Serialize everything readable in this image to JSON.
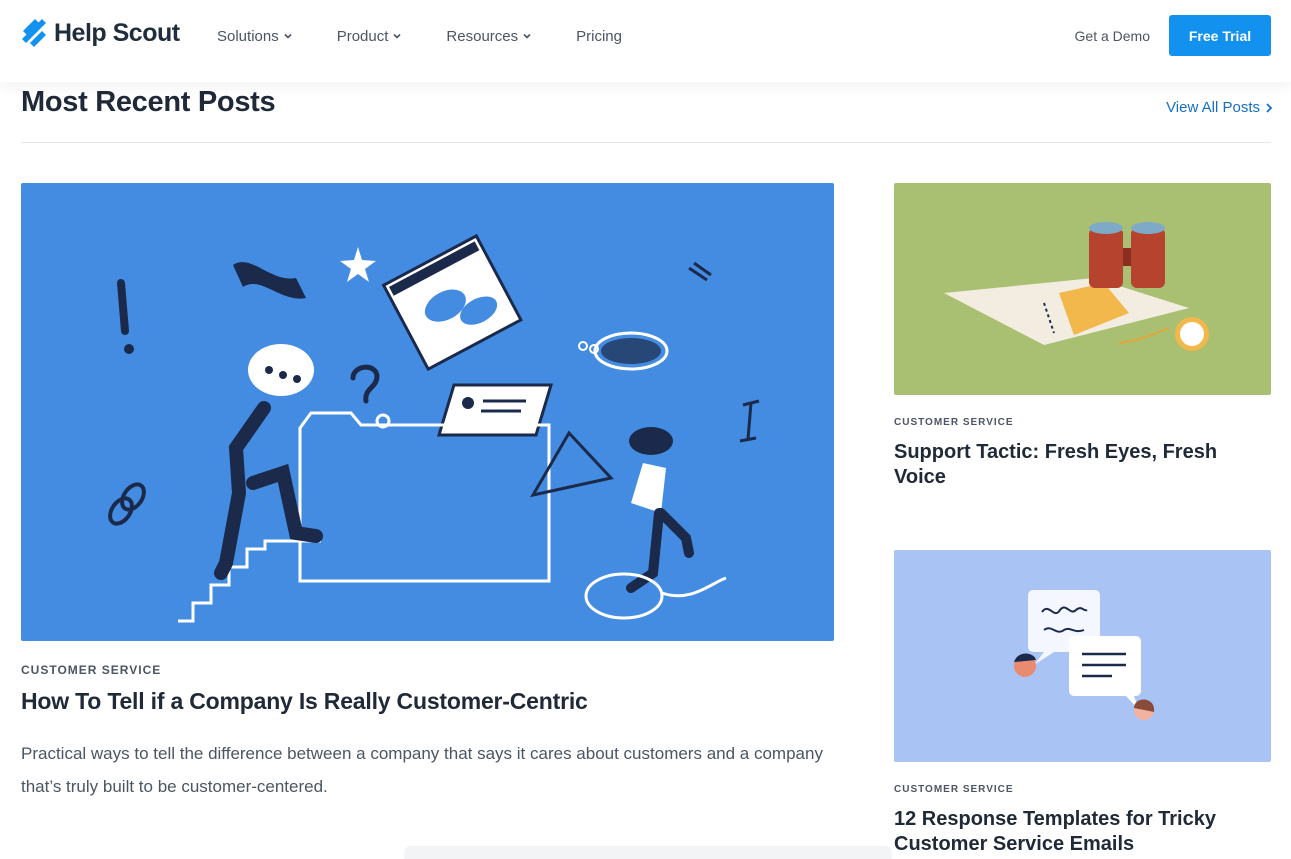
{
  "header": {
    "brand": "Help Scout",
    "nav": [
      {
        "label": "Solutions",
        "has_dropdown": true
      },
      {
        "label": "Product",
        "has_dropdown": true
      },
      {
        "label": "Resources",
        "has_dropdown": true
      },
      {
        "label": "Pricing",
        "has_dropdown": false
      }
    ],
    "demo_label": "Get a Demo",
    "trial_label": "Free Trial"
  },
  "section": {
    "title": "Most Recent Posts",
    "view_all": "View All Posts"
  },
  "featured": {
    "category": "CUSTOMER SERVICE",
    "title": "How To Tell if a Company Is Really Customer-Centric",
    "description": "Practical ways to tell the difference between a company that says it cares about customers and a company that’s truly built to be customer-centered."
  },
  "posts": [
    {
      "category": "CUSTOMER SERVICE",
      "title": "Support Tactic: Fresh Eyes, Fresh Voice"
    },
    {
      "category": "CUSTOMER SERVICE",
      "title": "12 Response Templates for Tricky Customer Service Emails"
    }
  ],
  "colors": {
    "accent": "#1292ee",
    "link": "#1570c2",
    "featured_bg": "#438ce2",
    "card1_bg": "#a9c072",
    "card2_bg": "#aac3f5"
  }
}
